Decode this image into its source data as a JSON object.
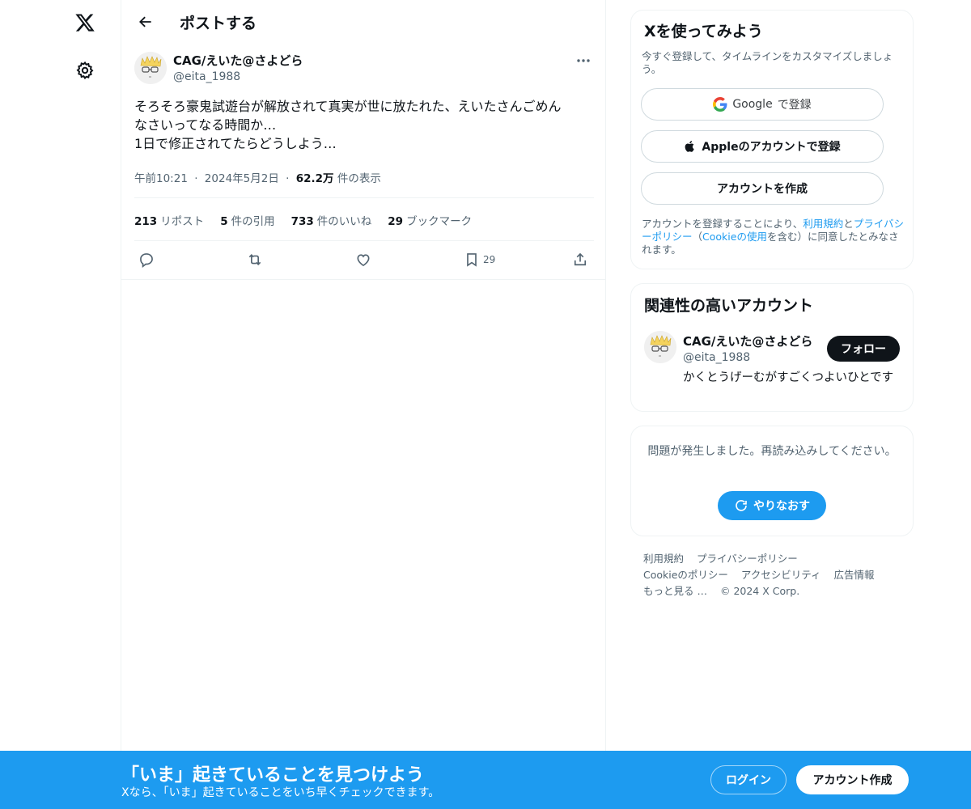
{
  "nav": {
    "logo_icon": "x-logo-icon",
    "settings_icon": "gear-icon"
  },
  "header": {
    "title": "ポストする"
  },
  "post": {
    "author_name": "CAG/えいた@さよどら",
    "author_handle": "@eita_1988",
    "text_lines": [
      "そろそろ豪鬼試遊台が解放されて真実が世に放たれた、えいたさんごめん",
      "なさいってなる時間か…",
      "1日で修正されてたらどうしよう…"
    ],
    "time": "午前10:21",
    "sep": "·",
    "date": "2024年5月2日",
    "views_value": "62.2万",
    "views_label": "件の表示",
    "stats": {
      "reposts_value": "213",
      "reposts_label": "リポスト",
      "quotes_value": "5",
      "quotes_label": "件の引用",
      "likes_value": "733",
      "likes_label": "件のいいね",
      "bookmarks_value": "29",
      "bookmarks_label": "ブックマーク"
    },
    "bookmark_count": "29"
  },
  "signup_card": {
    "title": "Xを使ってみよう",
    "subtitle": "今すぐ登録して、タイムラインをカスタマイズしましょう。",
    "google_brand": "Google",
    "google_suffix": "で登録",
    "apple_label": "Appleのアカウントで登録",
    "create_label": "アカウントを作成",
    "terms_prefix": "アカウントを登録することにより、",
    "terms_link": "利用規約",
    "terms_and": "と",
    "privacy_link": "プライバシーポリシー",
    "terms_paren_open": "（",
    "cookie_link": "Cookieの使用",
    "terms_paren_close": "を含む）に同意したとみなされます。"
  },
  "related_card": {
    "title": "関連性の高いアカウント",
    "name": "CAG/えいた@さよどら",
    "handle": "@eita_1988",
    "bio": "かくとうげーむがすごくつよいひとです",
    "follow_label": "フォロー"
  },
  "error_card": {
    "message": "問題が発生しました。再読み込みしてください。",
    "retry_label": "やりなおす"
  },
  "footer": {
    "terms": "利用規約",
    "privacy": "プライバシーポリシー",
    "cookie": "Cookieのポリシー",
    "accessibility": "アクセシビリティ",
    "ads": "広告情報",
    "more": "もっと見る …",
    "copyright": "© 2024 X Corp."
  },
  "banner": {
    "title": "「いま」起きていることを見つけよう",
    "subtitle": "Xなら、「いま」起きていることをいち早くチェックできます。",
    "login_label": "ログイン",
    "signup_label": "アカウント作成"
  },
  "colors": {
    "accent": "#1d9bf0",
    "text": "#0f1419",
    "secondary": "#536471"
  }
}
